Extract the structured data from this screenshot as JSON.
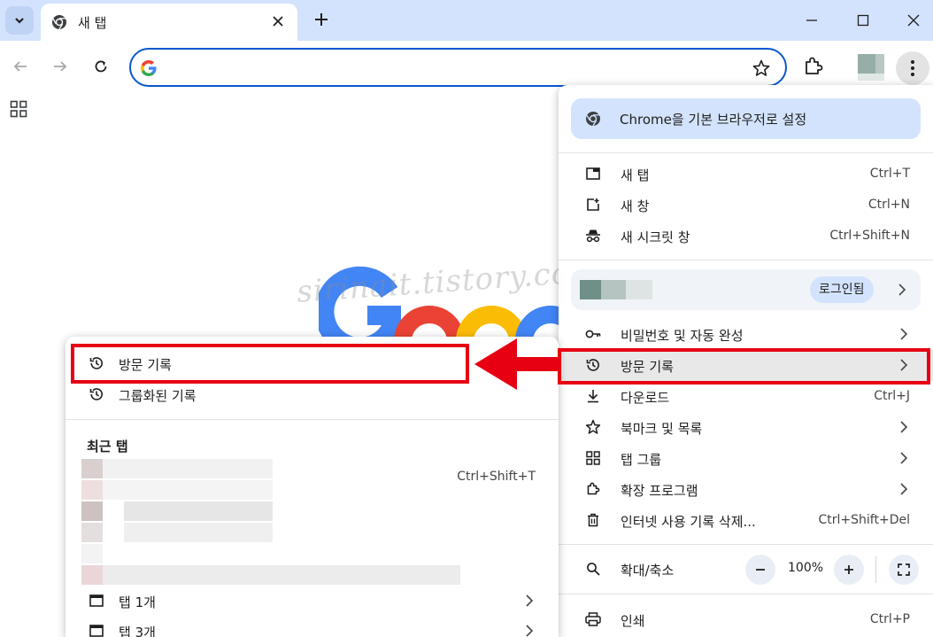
{
  "tab": {
    "title": "새 탭"
  },
  "page": {
    "watermark": "sirinait.tistory.com"
  },
  "menu": {
    "set_default": "Chrome을 기본 브라우저로 설정",
    "new_tab": {
      "label": "새 탭",
      "shortcut": "Ctrl+T"
    },
    "new_window": {
      "label": "새 창",
      "shortcut": "Ctrl+N"
    },
    "incognito": {
      "label": "새 시크릿 창",
      "shortcut": "Ctrl+Shift+N"
    },
    "sign_in": "로그인됨",
    "passwords": {
      "label": "비밀번호 및 자동 완성"
    },
    "history": {
      "label": "방문 기록"
    },
    "downloads": {
      "label": "다운로드",
      "shortcut": "Ctrl+J"
    },
    "bookmarks": {
      "label": "북마크 및 목록"
    },
    "tab_groups": {
      "label": "탭 그룹"
    },
    "extensions": {
      "label": "확장 프로그램"
    },
    "clear_data": {
      "label": "인터넷 사용 기록 삭제...",
      "shortcut": "Ctrl+Shift+Del"
    },
    "zoom": {
      "label": "확대/축소",
      "value": "100%"
    },
    "print": {
      "label": "인쇄",
      "shortcut": "Ctrl+P"
    }
  },
  "submenu": {
    "history": "방문 기록",
    "grouped_history": "그룹화된 기록",
    "recent_tabs_header": "최근 탭",
    "reopen_shortcut": "Ctrl+Shift+T",
    "tabs_1": "탭 1개",
    "tabs_3": "탭 3개"
  },
  "colors": {
    "accent": "#0b57d0",
    "annotation": "#e60012",
    "tabstrip": "#d3e3fd"
  }
}
